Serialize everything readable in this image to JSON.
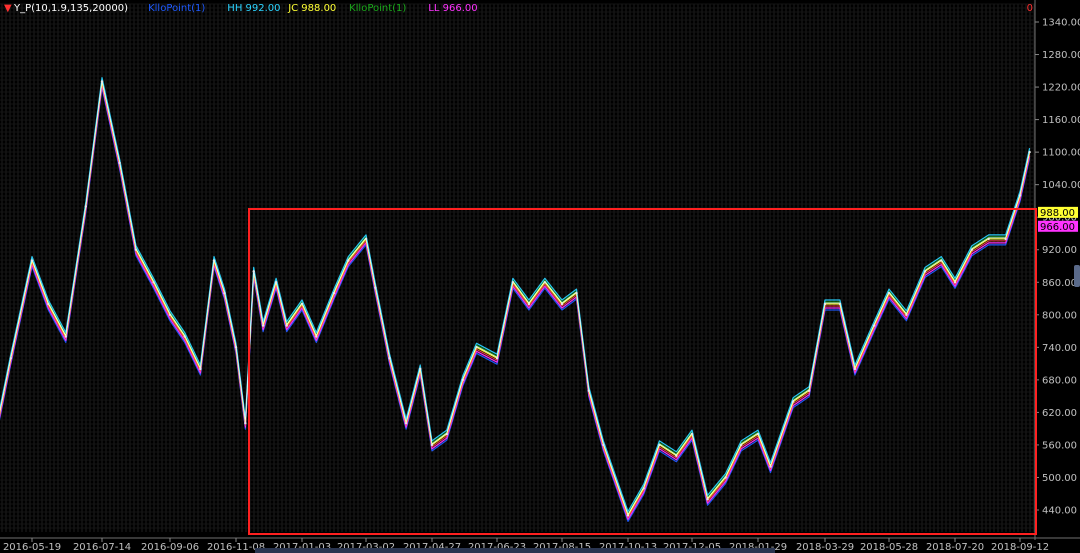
{
  "legend": {
    "indicator": "Y_P(10,1.9,135,20000)",
    "items": [
      {
        "label": "KlloPoint(1)",
        "value": "",
        "color": "#1f5bff"
      },
      {
        "label": "HH",
        "value": "992.00",
        "color": "#2ad3ff"
      },
      {
        "label": "JC",
        "value": "988.00",
        "color": "#ffff33"
      },
      {
        "label": "KlloPoint(1)",
        "value": "",
        "color": "#1aa81a"
      },
      {
        "label": "LL",
        "value": "966.00",
        "color": "#ff33ff"
      }
    ]
  },
  "corner_mark": "0",
  "price_tags": [
    {
      "value": "988.00",
      "bg": "#ffff33",
      "fg": "#000000"
    },
    {
      "value": "966.00",
      "bg": "#ff33ff",
      "fg": "#000000"
    }
  ],
  "bottom_corner_label": "",
  "chart_data": {
    "type": "line",
    "title": "",
    "xlabel": "",
    "ylabel": "",
    "ylim": [
      400,
      1360
    ],
    "grid": true,
    "legend_position": "top-left",
    "y_ticks": [
      "1340.00",
      "1280.00",
      "1220.00",
      "1160.00",
      "1100.00",
      "1040.00",
      "980.00",
      "920.00",
      "860.00",
      "800.00",
      "740.00",
      "680.00",
      "620.00",
      "560.00",
      "500.00",
      "440.00"
    ],
    "x_ticks": [
      "2016-05-19",
      "2016-07-14",
      "2016-09-06",
      "2016-11-08",
      "2017-01-03",
      "2017-03-02",
      "2017-04-27",
      "2017-06-23",
      "2017-08-15",
      "2017-10-13",
      "2017-12-05",
      "2018-01-29",
      "2018-03-29",
      "2018-05-28",
      "2018-07-20",
      "2018-09-12"
    ],
    "x": [
      "2016-04-18",
      "2016-05-02",
      "2016-05-19",
      "2016-06-01",
      "2016-06-15",
      "2016-07-01",
      "2016-07-14",
      "2016-07-28",
      "2016-08-10",
      "2016-08-24",
      "2016-09-06",
      "2016-09-20",
      "2016-10-05",
      "2016-10-18",
      "2016-10-28",
      "2016-11-08",
      "2016-11-16",
      "2016-11-23",
      "2016-12-01",
      "2016-12-12",
      "2016-12-21",
      "2017-01-03",
      "2017-01-16",
      "2017-02-01",
      "2017-02-14",
      "2017-03-02",
      "2017-03-10",
      "2017-03-22",
      "2017-04-05",
      "2017-04-17",
      "2017-04-27",
      "2017-05-10",
      "2017-05-24",
      "2017-06-05",
      "2017-06-23",
      "2017-07-06",
      "2017-07-19",
      "2017-08-01",
      "2017-08-15",
      "2017-08-28",
      "2017-09-08",
      "2017-09-21",
      "2017-10-13",
      "2017-10-26",
      "2017-11-08",
      "2017-11-22",
      "2017-12-05",
      "2017-12-18",
      "2018-01-02",
      "2018-01-15",
      "2018-01-29",
      "2018-02-09",
      "2018-03-01",
      "2018-03-15",
      "2018-03-29",
      "2018-04-12",
      "2018-04-26",
      "2018-05-14",
      "2018-05-28",
      "2018-06-11",
      "2018-06-26",
      "2018-07-09",
      "2018-07-20",
      "2018-08-03",
      "2018-08-17",
      "2018-08-31",
      "2018-09-12",
      "2018-09-20"
    ],
    "series": [
      {
        "values": [
          560,
          720,
          900,
          820,
          760,
          1000,
          1230,
          1080,
          920,
          860,
          800,
          760,
          700,
          900,
          840,
          740,
          600,
          880,
          780,
          860,
          780,
          820,
          760,
          840,
          900,
          940,
          850,
          720,
          600,
          700,
          560,
          580,
          680,
          740,
          720,
          860,
          820,
          860,
          820,
          840,
          660,
          560,
          430,
          480,
          560,
          540,
          580,
          460,
          500,
          560,
          580,
          520,
          640,
          660,
          820,
          820,
          700,
          780,
          840,
          800,
          880,
          900,
          860,
          920,
          940,
          940,
          1020,
          1100
        ]
      }
    ]
  }
}
